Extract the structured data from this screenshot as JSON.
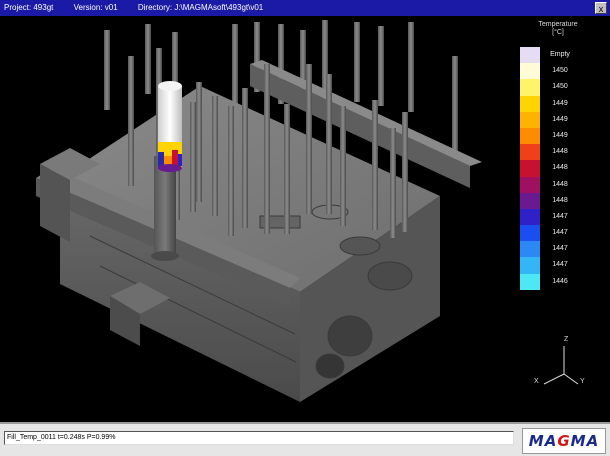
{
  "titlebar": {
    "project": "Project: 493gt",
    "version": "Version: v01",
    "directory": "Directory: J:\\MAGMAsoft\\493gt\\v01",
    "close": "x"
  },
  "legend": {
    "title": "Temperature",
    "unit": "[°C]",
    "entries": [
      {
        "label": "Empty",
        "color": "#e6ddf5"
      },
      {
        "label": "1450",
        "color": "#fffbd6"
      },
      {
        "label": "1450",
        "color": "#fff36a"
      },
      {
        "label": "1449",
        "color": "#ffd400"
      },
      {
        "label": "1449",
        "color": "#ffb300"
      },
      {
        "label": "1449",
        "color": "#ff8c00"
      },
      {
        "label": "1448",
        "color": "#f04018"
      },
      {
        "label": "1448",
        "color": "#c81030"
      },
      {
        "label": "1448",
        "color": "#a01060"
      },
      {
        "label": "1448",
        "color": "#6a1a90"
      },
      {
        "label": "1447",
        "color": "#3020c8"
      },
      {
        "label": "1447",
        "color": "#1a4ef0"
      },
      {
        "label": "1447",
        "color": "#2c88f5"
      },
      {
        "label": "1447",
        "color": "#34b6f6"
      },
      {
        "label": "1446",
        "color": "#4ee8f5"
      }
    ]
  },
  "axes": {
    "x": "X",
    "y": "Y",
    "z": "Z"
  },
  "status": {
    "text": "Fill_Temp_0011 t=0.248s P=0.99%"
  },
  "logo": {
    "left": "MA",
    "accent": "G",
    "right": "MA"
  },
  "colors": {
    "titlebar": "#1a1aa6",
    "background": "#000000",
    "casting": "#6f6f6f"
  }
}
